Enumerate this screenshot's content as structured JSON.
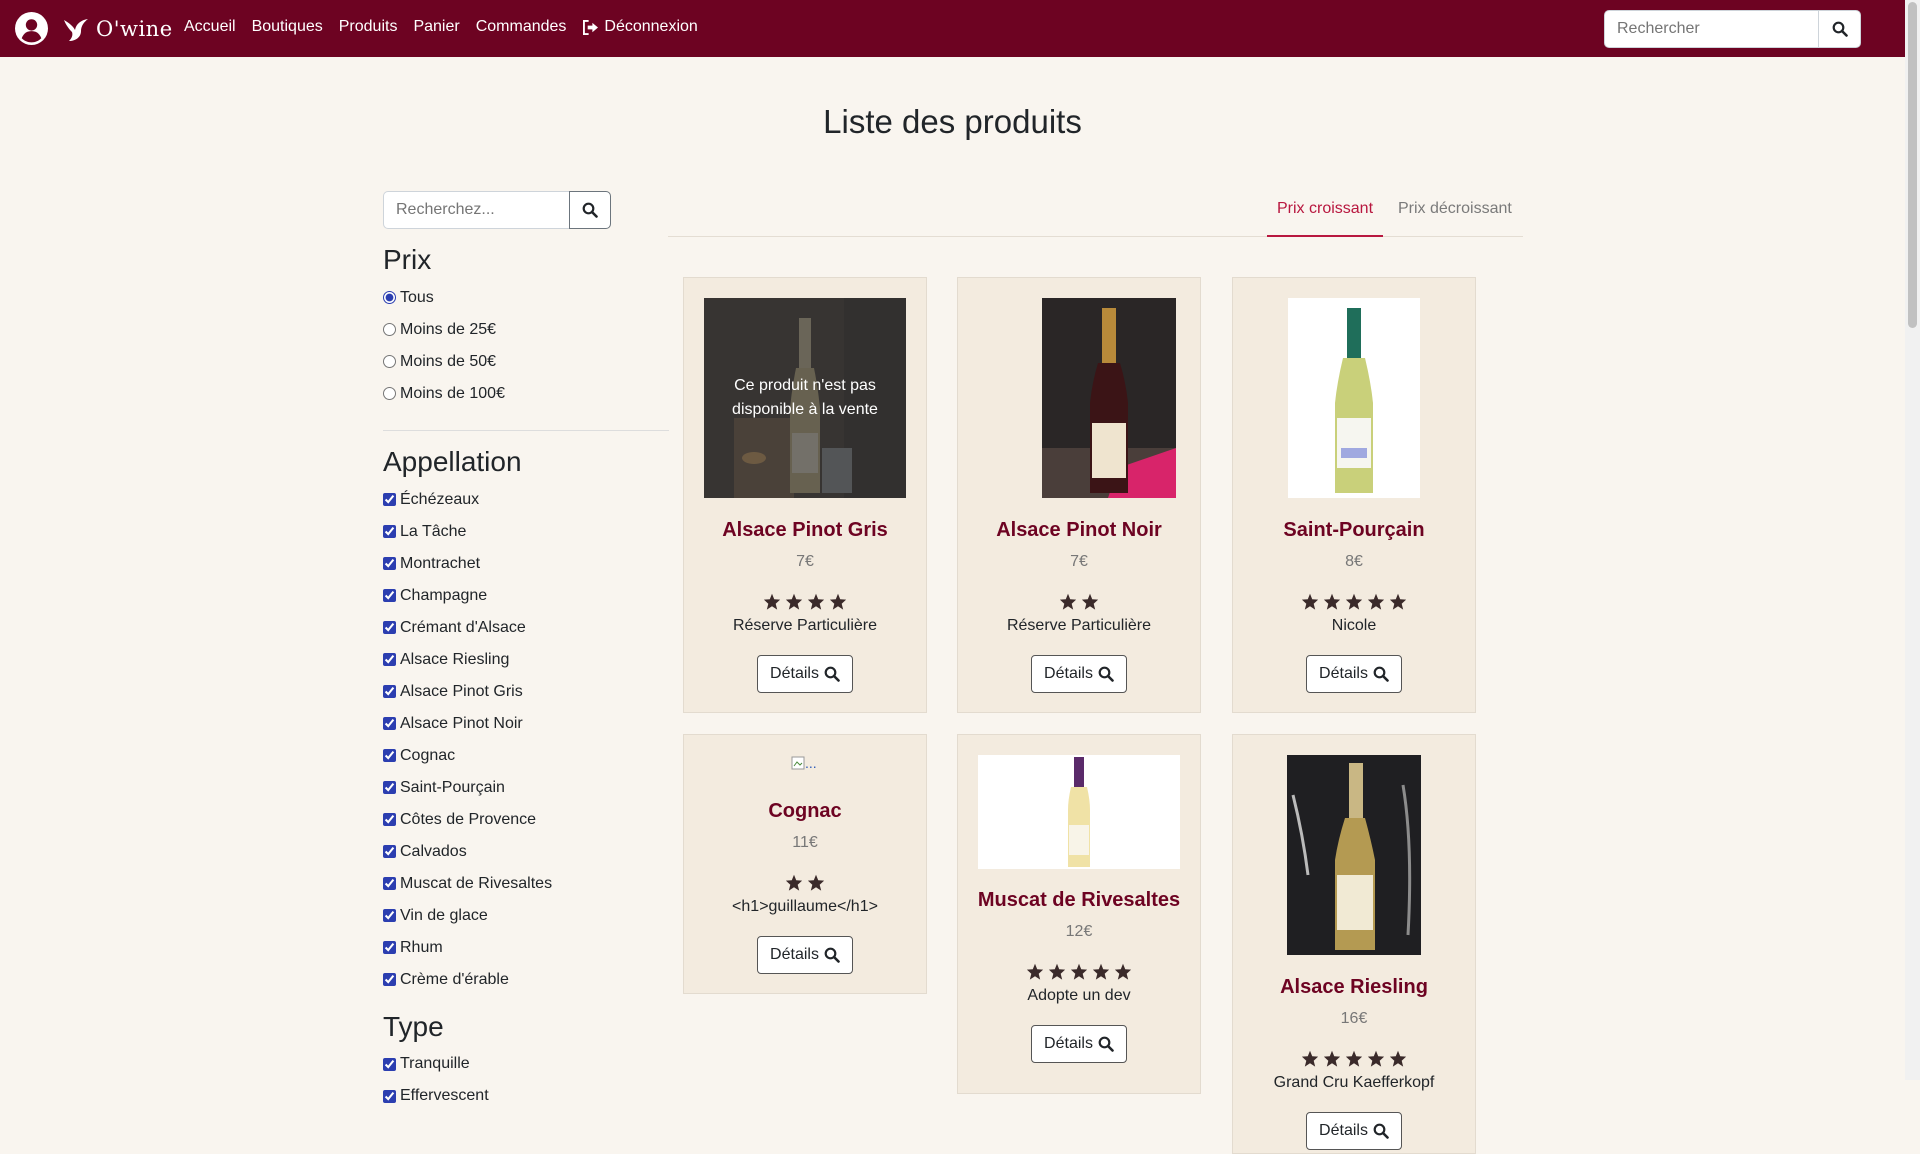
{
  "nav": {
    "brand": "O'wine",
    "links": [
      "Accueil",
      "Boutiques",
      "Produits",
      "Panier",
      "Commandes",
      "Déconnexion"
    ],
    "search_placeholder": "Rechercher"
  },
  "page_title": "Liste des produits",
  "sidebar": {
    "search_placeholder": "Recherchez...",
    "price": {
      "title": "Prix",
      "options": [
        "Tous",
        "Moins de 25€",
        "Moins de 50€",
        "Moins de 100€"
      ],
      "selected": "Tous"
    },
    "appellation": {
      "title": "Appellation",
      "items": [
        "Échézeaux",
        "La Tâche",
        "Montrachet",
        "Champagne",
        "Crémant d'Alsace",
        "Alsace Riesling",
        "Alsace Pinot Gris",
        "Alsace Pinot Noir",
        "Cognac",
        "Saint-Pourçain",
        "Côtes de Provence",
        "Calvados",
        "Muscat de Rivesaltes",
        "Vin de glace",
        "Rhum",
        "Crème d'érable"
      ]
    },
    "type": {
      "title": "Type",
      "items": [
        "Tranquille",
        "Effervescent"
      ]
    }
  },
  "sort_tabs": {
    "items": [
      "Prix croissant",
      "Prix décroissant"
    ],
    "active": "Prix croissant"
  },
  "products": [
    {
      "name": "Alsace Pinot Gris",
      "price": "7€",
      "rating": 4,
      "seller": "Réserve Particulière",
      "unavailable_text": "Ce produit n'est pas disponible à la vente",
      "button": "Détails"
    },
    {
      "name": "Alsace Pinot Noir",
      "price": "7€",
      "rating": 2,
      "seller": "Réserve Particulière",
      "button": "Détails"
    },
    {
      "name": "Saint-Pourçain",
      "price": "8€",
      "rating": 5,
      "seller": "Nicole",
      "button": "Détails"
    },
    {
      "name": "Cognac",
      "price": "11€",
      "rating": 2,
      "seller": "<h1>guillaume</h1>",
      "image_alt": "...",
      "button": "Détails"
    },
    {
      "name": "Muscat de Rivesaltes",
      "price": "12€",
      "rating": 5,
      "seller": "Adopte un dev",
      "button": "Détails"
    },
    {
      "name": "Alsace Riesling",
      "price": "16€",
      "rating": 5,
      "seller": "Grand Cru Kaefferkopf",
      "button": "Détails"
    }
  ],
  "colors": {
    "brand": "#6d0322",
    "accent": "#b8173f",
    "card_bg": "#f3ebdf",
    "page_bg": "#f9f5ef"
  }
}
